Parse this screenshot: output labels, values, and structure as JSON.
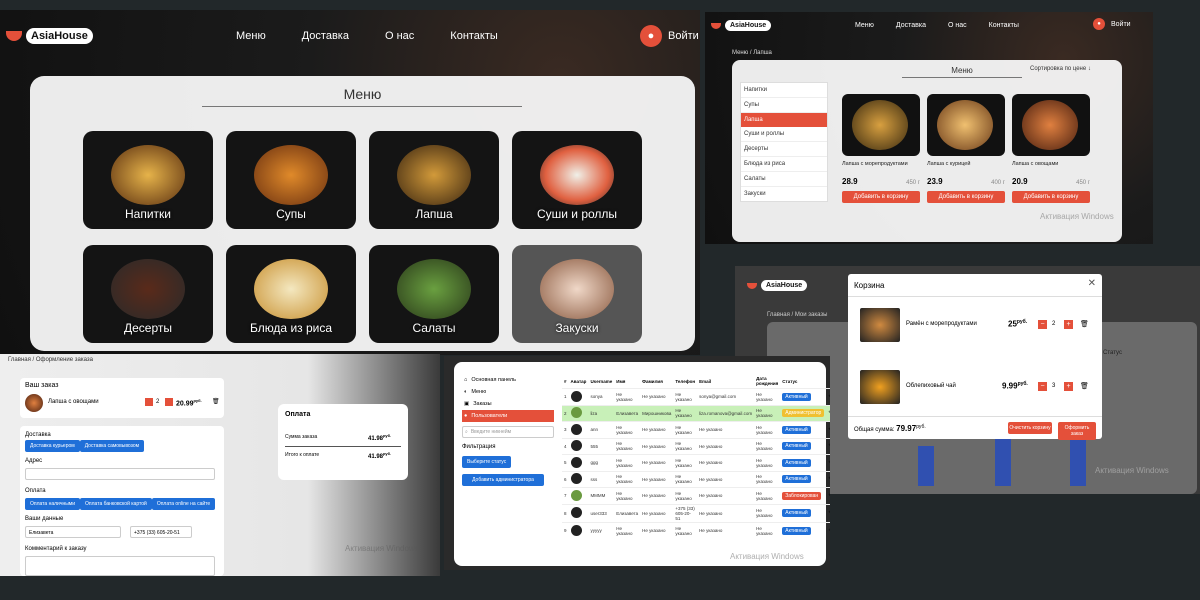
{
  "menu_page": {
    "logo": "AsiaHouse",
    "nav": [
      "Меню",
      "Доставка",
      "О нас",
      "Контакты"
    ],
    "login": "Войти",
    "title": "Меню",
    "categories": [
      "Напитки",
      "Супы",
      "Лапша",
      "Суши и роллы",
      "Десерты",
      "Блюда из риса",
      "Салаты",
      "Закуски"
    ]
  },
  "catalog": {
    "logo": "AsiaHouse",
    "nav": [
      "Меню",
      "Доставка",
      "О нас",
      "Контакты"
    ],
    "login": "Войти",
    "breadcrumb": "Меню / Лапша",
    "title": "Меню",
    "sort": "Сортировка по цене",
    "sidebar": [
      "Напитки",
      "Супы",
      "Лапша",
      "Суши и роллы",
      "Десерты",
      "Блюда из риса",
      "Салаты",
      "Закуски"
    ],
    "active_index": 2,
    "products": [
      {
        "name": "Лапша с морепродуктами",
        "price": "28.9",
        "currency": "руб.",
        "weight": "450 г",
        "button": "Добавить в корзину"
      },
      {
        "name": "Лапша с курицей",
        "price": "23.9",
        "currency": "руб.",
        "weight": "400 г",
        "button": "Добавить в корзину"
      },
      {
        "name": "Лапша с овощами",
        "price": "20.9",
        "currency": "руб.",
        "weight": "450 г",
        "button": "Добавить в корзину"
      }
    ],
    "watermark": "Активация Windows"
  },
  "cart": {
    "logo": "AsiaHouse",
    "breadcrumb": "Главная / Мои заказы",
    "title": "Корзина",
    "items": [
      {
        "name": "Рамён с морепродуктами",
        "price": "25",
        "currency": "руб.",
        "qty": "2"
      },
      {
        "name": "Облепиховый чай",
        "price": "9.99",
        "currency": "руб.",
        "qty": "3"
      }
    ],
    "total_label": "Общая сумма:",
    "total": "79.97",
    "total_currency": "руб.",
    "clear_button": "Очистить корзину",
    "checkout_button": "Оформить заказ",
    "status_label": "Статус",
    "watermark": "Активация Windows"
  },
  "checkout": {
    "breadcrumb": "Главная / Оформление заказа",
    "order_title": "Ваш заказ",
    "order_item": {
      "name": "Лапша с овощами",
      "qty": "2",
      "price": "20.99",
      "currency": "руб."
    },
    "delivery_label": "Доставка",
    "delivery_options": [
      "Доставка курьером",
      "Доставка самовывозом"
    ],
    "address_label": "Адрес",
    "payment_label": "Оплата",
    "payment_options": [
      "Оплата наличными",
      "Оплата банковской картой",
      "Оплата online на сайте"
    ],
    "your_data_label": "Ваши данные",
    "name_value": "Елизавета",
    "phone_value": "+375 (33) 605-20-51",
    "comment_label": "Комментарий к заказу",
    "payment_card_title": "Оплата",
    "sum_label": "Сумма заказа",
    "sum_value": "41.98",
    "sum_currency": "руб.",
    "total_label": "Итого к оплате",
    "total_value": "41.98",
    "total_currency": "руб.",
    "watermark": "Активация Windows"
  },
  "admin": {
    "menu": [
      "Основная панель",
      "Меню",
      "Заказы",
      "Пользователи"
    ],
    "active_index": 3,
    "search_placeholder": "Введите никнейм",
    "filter_label": "Фильтрация",
    "status_select": "Выберите статус",
    "add_admin": "Добавить администратора",
    "columns": [
      "#",
      "Аватар",
      "Username",
      "Имя",
      "Фамилия",
      "Телефон",
      "Email",
      "Дата рождения",
      "Статус"
    ],
    "rows": [
      {
        "n": "1",
        "user": "sonya",
        "first": "Не указано",
        "last": "Не указано",
        "phone": "Не указано",
        "email": "sonya@gmail.com",
        "birth": "Не указано",
        "status": "Активный",
        "color": "#1f6fd8"
      },
      {
        "n": "2",
        "user": "liza",
        "first": "Елизавета",
        "last": "Мирошникова",
        "phone": "Не указано",
        "email": "liza.romanova@gmail.com",
        "birth": "Не указано",
        "status": "Администратор",
        "color": "#f0c030"
      },
      {
        "n": "3",
        "user": "ann",
        "first": "Не указано",
        "last": "Не указано",
        "phone": "Не указано",
        "email": "Не указано",
        "birth": "Не указано",
        "status": "Активный",
        "color": "#1f6fd8"
      },
      {
        "n": "4",
        "user": "555",
        "first": "Не указано",
        "last": "Не указано",
        "phone": "Не указано",
        "email": "Не указано",
        "birth": "Не указано",
        "status": "Активный",
        "color": "#1f6fd8"
      },
      {
        "n": "5",
        "user": "ggg",
        "first": "Не указано",
        "last": "Не указано",
        "phone": "Не указано",
        "email": "Не указано",
        "birth": "Не указано",
        "status": "Активный",
        "color": "#1f6fd8"
      },
      {
        "n": "6",
        "user": "sss",
        "first": "Не указано",
        "last": "Не указано",
        "phone": "Не указано",
        "email": "Не указано",
        "birth": "Не указано",
        "status": "Активный",
        "color": "#1f6fd8"
      },
      {
        "n": "7",
        "user": "MMMM",
        "first": "Не указано",
        "last": "Не указано",
        "phone": "Не указано",
        "email": "Не указано",
        "birth": "Не указано",
        "status": "Заблокирован",
        "color": "#e4503a"
      },
      {
        "n": "8",
        "user": "user333",
        "first": "Елизавета",
        "last": "Не указано",
        "phone": "+375 (33) 605-20-51",
        "email": "Не указано",
        "birth": "Не указано",
        "status": "Активный",
        "color": "#1f6fd8"
      },
      {
        "n": "9",
        "user": "yyyyy",
        "first": "Не указано",
        "last": "Не указано",
        "phone": "Не указано",
        "email": "Не указано",
        "birth": "Не указано",
        "status": "Активный",
        "color": "#1f6fd8"
      }
    ],
    "watermark": "Активация Windows"
  }
}
